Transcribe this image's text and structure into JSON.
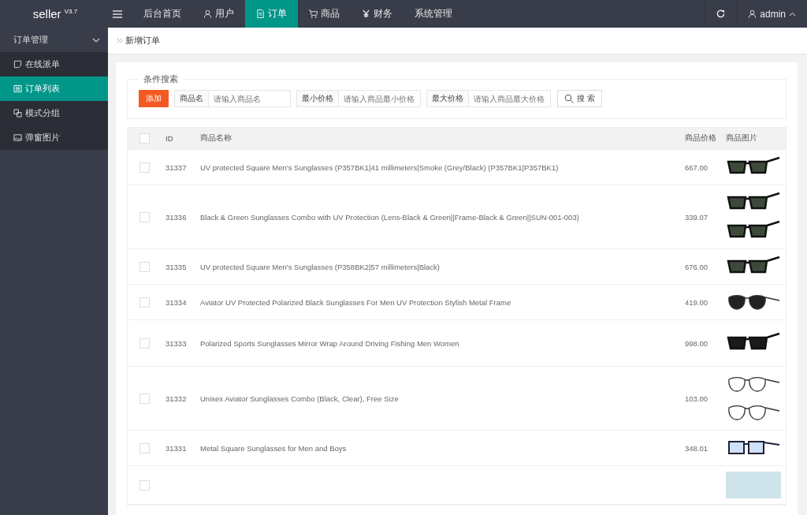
{
  "logo": {
    "name": "seller",
    "version": "V3.7"
  },
  "nav": [
    {
      "label": "后台首页",
      "selected": false
    },
    {
      "label": "用户",
      "selected": false
    },
    {
      "label": "订单",
      "selected": true
    },
    {
      "label": "商品",
      "selected": false
    },
    {
      "label": "财务",
      "selected": false
    },
    {
      "label": "系统管理",
      "selected": false
    }
  ],
  "user": {
    "name": "admin"
  },
  "sidebar": {
    "group": {
      "label": "订单管理",
      "expanded": true
    },
    "items": [
      {
        "label": "在线派单",
        "selected": false
      },
      {
        "label": "订单列表",
        "selected": true
      },
      {
        "label": "模式分组",
        "selected": false
      },
      {
        "label": "弹窗图片",
        "selected": false
      }
    ]
  },
  "breadcrumb": "新增订单",
  "search": {
    "legend": "条件搜索",
    "add_button": "添加",
    "fields": [
      {
        "label": "商品名",
        "placeholder": "请输入商品名"
      },
      {
        "label": "最小价格",
        "placeholder": "请输入商品最小价格"
      },
      {
        "label": "最大价格",
        "placeholder": "请输入商品最大价格"
      }
    ],
    "search_button": "搜 索"
  },
  "table": {
    "select_all": {
      "checked": false
    },
    "columns": [
      "ID",
      "商品名称",
      "商品价格",
      "商品图片"
    ],
    "rows": [
      {
        "id": "31337",
        "name": "UV protected Square Men's Sunglasses (P357BK1|41 millimeters|Smoke (Grey/Black) (P357BK1|P357BK1)",
        "price": "667.00",
        "checked": false,
        "images": [
          {
            "kind": "sunglasses"
          }
        ]
      },
      {
        "id": "31336",
        "name": "Black & Green Sunglasses Combo with UV Protection (Lens-Black & Green||Frame-Black & Green||SUN-001-003)",
        "price": "339.07",
        "checked": false,
        "images": [
          {
            "kind": "sunglasses"
          },
          {
            "kind": "sunglasses"
          }
        ]
      },
      {
        "id": "31335",
        "name": "UV protected Square Men's Sunglasses (P358BK2|57 millimeters|Black)",
        "price": "676.00",
        "checked": false,
        "images": [
          {
            "kind": "sunglasses"
          }
        ]
      },
      {
        "id": "31334",
        "name": "Aviator UV Protected Polarized Black Sunglasses For Men UV Protection Stylish Metal Frame",
        "price": "419.00",
        "checked": false,
        "images": [
          {
            "kind": "aviator"
          }
        ]
      },
      {
        "id": "31333",
        "name": "Polarized Sports Sunglasses Mirror Wrap Around Driving Fishing Men Women",
        "price": "998.00",
        "checked": false,
        "images": [
          {
            "kind": "sport"
          }
        ]
      },
      {
        "id": "31332",
        "name": "Unisex Aviator Sunglasses Combo (Black, Clear), Free Size",
        "price": "103.00",
        "checked": false,
        "images": [
          {
            "kind": "clear"
          },
          {
            "kind": "clear"
          }
        ]
      },
      {
        "id": "31331",
        "name": "Metal Square Sunglasses for Men and Boys",
        "price": "348.01",
        "checked": false,
        "images": [
          {
            "kind": "blue"
          }
        ]
      },
      {
        "checked": false,
        "images": [
          {
            "kind": "artwork"
          }
        ]
      }
    ]
  }
}
